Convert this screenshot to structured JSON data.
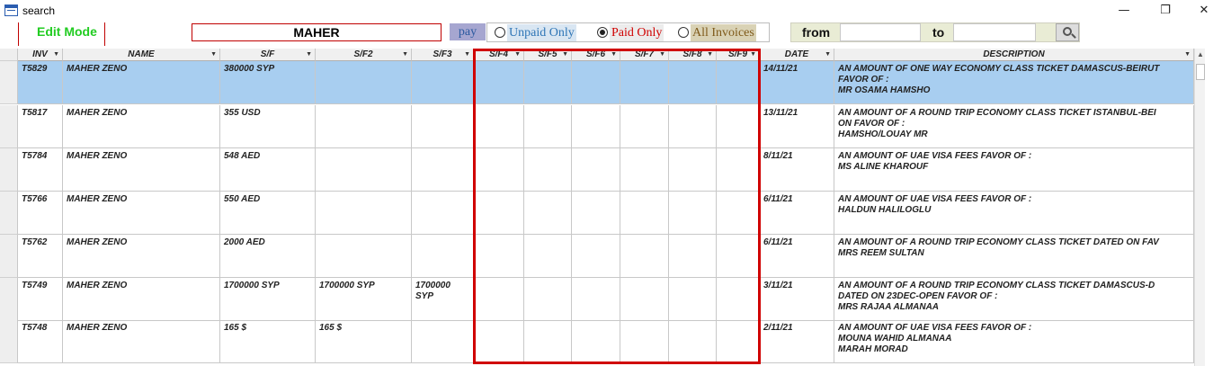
{
  "window": {
    "title": "search",
    "minimize": "—",
    "maximize": "❐",
    "close": "✕"
  },
  "toolbar": {
    "edit_mode": "Edit Mode",
    "search_value": "MAHER",
    "pay_label": "pay",
    "radios": [
      {
        "label": "Unpaid Only",
        "checked": false
      },
      {
        "label": "Paid Only",
        "checked": true
      },
      {
        "label": "All Invoices",
        "checked": false
      }
    ],
    "from_label": "from",
    "to_label": "to",
    "from_value": "",
    "to_value": ""
  },
  "table": {
    "columns": [
      "INV",
      "NAME",
      "S/F",
      "S/F2",
      "S/F3",
      "S/F4",
      "S/F5",
      "S/F6",
      "S/F7",
      "S/F8",
      "S/F9",
      "DATE",
      "DESCRIPTION"
    ],
    "rows": [
      {
        "selected": true,
        "cells": [
          "T5829",
          "MAHER ZENO",
          "380000 SYP",
          "",
          "",
          "",
          "",
          "",
          "",
          "",
          "",
          "14/11/21",
          "AN AMOUNT OF ONE WAY ECONOMY CLASS TICKET DAMASCUS-BEIRUT\nFAVOR OF :\nMR OSAMA HAMSHO"
        ]
      },
      {
        "selected": false,
        "cells": [
          "T5817",
          "MAHER ZENO",
          "355 USD",
          "",
          "",
          "",
          "",
          "",
          "",
          "",
          "",
          "13/11/21",
          "AN AMOUNT OF A ROUND TRIP ECONOMY CLASS TICKET ISTANBUL-BEI\nON FAVOR OF :\nHAMSHO/LOUAY MR"
        ]
      },
      {
        "selected": false,
        "cells": [
          "T5784",
          "MAHER ZENO",
          "548 AED",
          "",
          "",
          "",
          "",
          "",
          "",
          "",
          "",
          "8/11/21",
          "AN AMOUNT OF UAE VISA FEES FAVOR OF :\nMS ALINE KHAROUF"
        ]
      },
      {
        "selected": false,
        "cells": [
          "T5766",
          "MAHER ZENO",
          "550 AED",
          "",
          "",
          "",
          "",
          "",
          "",
          "",
          "",
          "6/11/21",
          "AN AMOUNT OF UAE VISA FEES FAVOR OF :\nHALDUN HALILOGLU"
        ]
      },
      {
        "selected": false,
        "cells": [
          "T5762",
          "MAHER ZENO",
          "2000 AED",
          "",
          "",
          "",
          "",
          "",
          "",
          "",
          "",
          "6/11/21",
          "AN AMOUNT OF A ROUND TRIP ECONOMY CLASS TICKET DATED ON FAV\nMRS REEM SULTAN"
        ]
      },
      {
        "selected": false,
        "cells": [
          "T5749",
          "MAHER ZENO",
          "1700000 SYP",
          "1700000 SYP",
          "1700000\nSYP",
          "",
          "",
          "",
          "",
          "",
          "",
          "3/11/21",
          "AN AMOUNT OF A ROUND TRIP ECONOMY CLASS TICKET DAMASCUS-D\nDATED ON 23DEC-OPEN FAVOR OF :\nMRS RAJAA ALMANAA"
        ]
      },
      {
        "selected": false,
        "cells": [
          "T5748",
          "MAHER ZENO",
          "165 $",
          "165 $",
          "",
          "",
          "",
          "",
          "",
          "",
          "",
          "2/11/21",
          "AN AMOUNT OF UAE VISA FEES FAVOR OF :\nMOUNA WAHID ALMANAA\nMARAH MORAD"
        ]
      }
    ]
  },
  "colors": {
    "highlight_box": "#d00000",
    "selected_row": "#a8cef0",
    "edit_mode": "#22cc22"
  }
}
